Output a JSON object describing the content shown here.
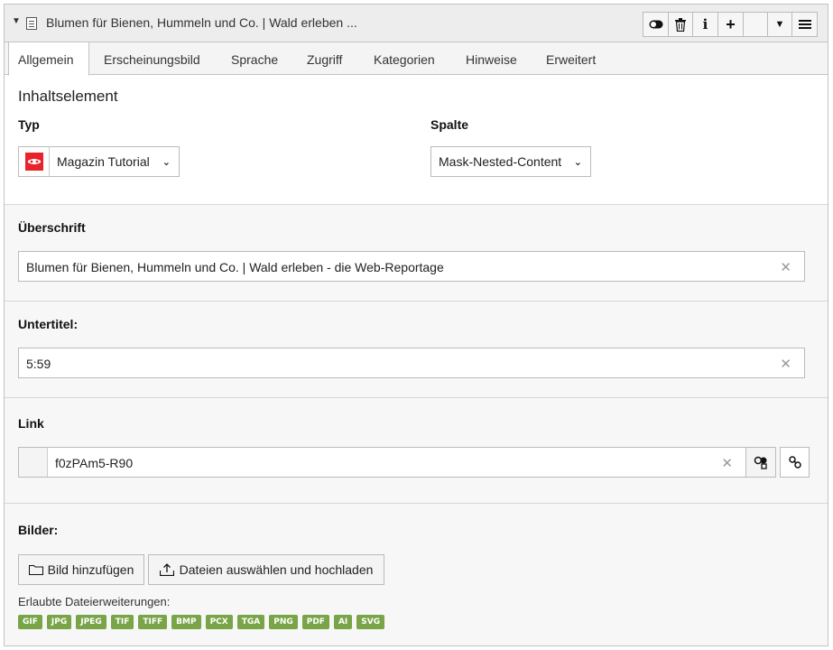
{
  "header": {
    "title": "Blumen für Bienen, Hummeln und Co. | Wald erleben ...",
    "toolbar": {
      "toggle_icon": "toggle-icon",
      "delete_icon": "trash-icon",
      "info_label": "i",
      "add_label": "+",
      "dropdown_icon": "caret-down-icon",
      "menu_icon": "hamburger-icon"
    }
  },
  "tabs": [
    "Allgemein",
    "Erscheinungsbild",
    "Sprache",
    "Zugriff",
    "Kategorien",
    "Hinweise",
    "Erweitert"
  ],
  "general": {
    "section_title": "Inhaltselement",
    "type_label": "Typ",
    "type_value": "Magazin Tutorial",
    "column_label": "Spalte",
    "column_value": "Mask-Nested-Content"
  },
  "heading": {
    "label": "Überschrift",
    "value": "Blumen für Bienen, Hummeln und Co. | Wald erleben - die Web-Reportage"
  },
  "subtitle": {
    "label": "Untertitel:",
    "value": "5:59"
  },
  "link": {
    "label": "Link",
    "value": "f0zPAm5-R90"
  },
  "images": {
    "label": "Bilder:",
    "add_button": "Bild hinzufügen",
    "upload_button": "Dateien auswählen und hochladen",
    "allowed_label": "Erlaubte Dateierweiterungen:",
    "extensions": [
      "GIF",
      "JPG",
      "JPEG",
      "TIF",
      "TIFF",
      "BMP",
      "PCX",
      "TGA",
      "PNG",
      "PDF",
      "AI",
      "SVG"
    ]
  },
  "colors": {
    "badge_green": "#79a548",
    "type_icon_red": "#e8232b"
  }
}
